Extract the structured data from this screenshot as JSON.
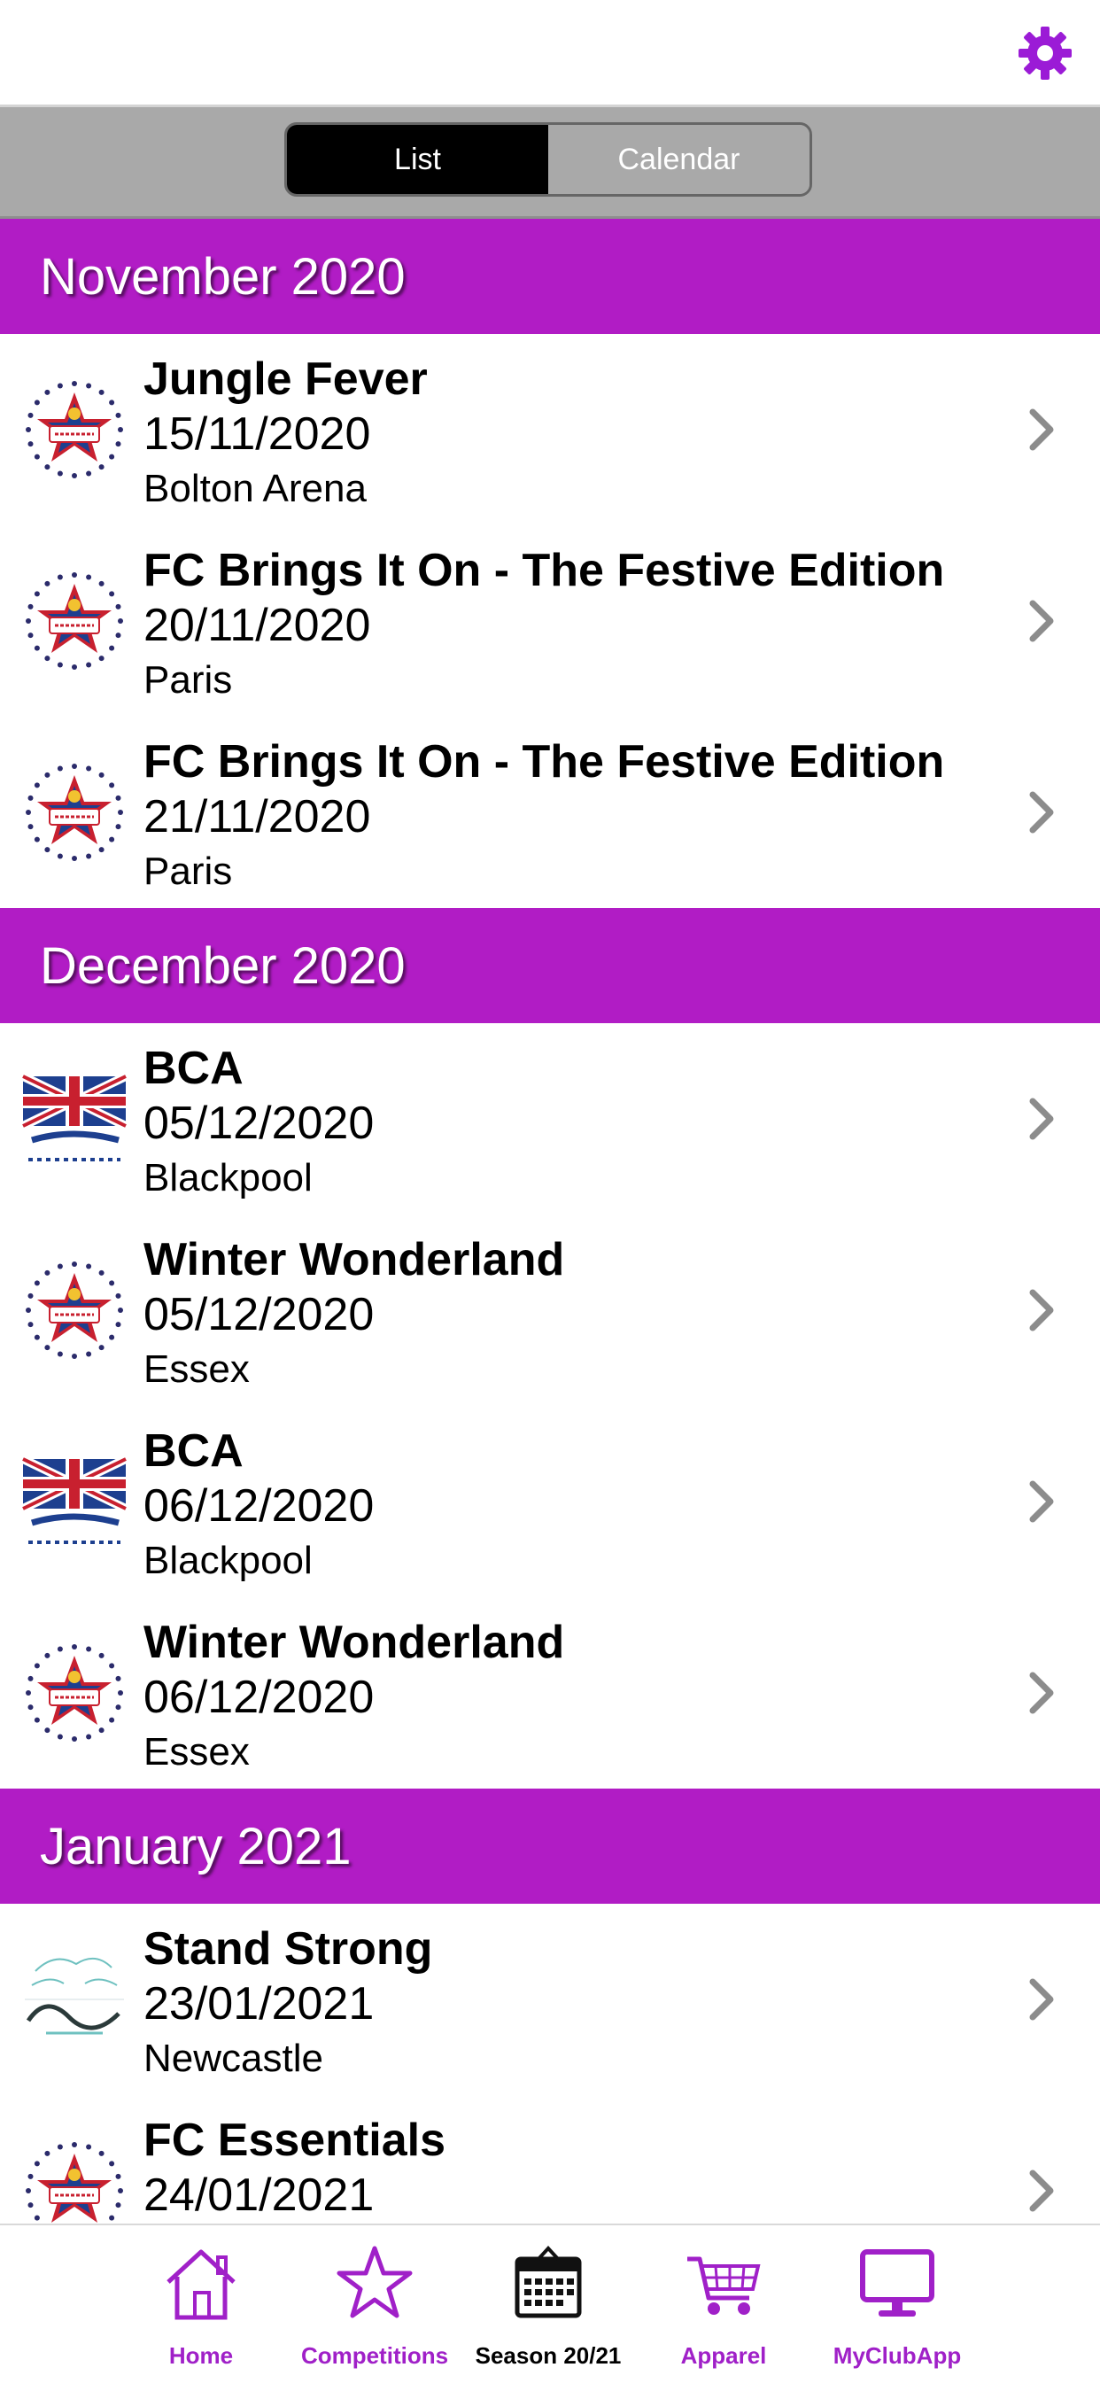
{
  "segmented": {
    "options": [
      "List",
      "Calendar"
    ],
    "selected": "List"
  },
  "months": [
    {
      "title": "November 2020",
      "events": [
        {
          "name": "Jungle Fever",
          "date": "15/11/2020",
          "venue": "Bolton Arena",
          "logo": "future-cheer"
        },
        {
          "name": "FC Brings It On - The Festive Edition",
          "date": "20/11/2020",
          "venue": "Paris",
          "logo": "future-cheer"
        },
        {
          "name": "FC Brings It On - The Festive Edition",
          "date": "21/11/2020",
          "venue": "Paris",
          "logo": "future-cheer"
        }
      ]
    },
    {
      "title": "December 2020",
      "events": [
        {
          "name": "BCA",
          "date": "05/12/2020",
          "venue": "Blackpool",
          "logo": "bca"
        },
        {
          "name": "Winter Wonderland",
          "date": "05/12/2020",
          "venue": "Essex",
          "logo": "future-cheer"
        },
        {
          "name": "BCA",
          "date": "06/12/2020",
          "venue": "Blackpool",
          "logo": "bca"
        },
        {
          "name": "Winter Wonderland",
          "date": "06/12/2020",
          "venue": "Essex",
          "logo": "future-cheer"
        }
      ]
    },
    {
      "title": "January 2021",
      "events": [
        {
          "name": "Stand Strong",
          "date": "23/01/2021",
          "venue": "Newcastle",
          "logo": "legacy"
        },
        {
          "name": "FC Essentials",
          "date": "24/01/2021",
          "venue": "",
          "logo": "future-cheer"
        }
      ]
    }
  ],
  "tabs": [
    {
      "label": "Home",
      "icon": "home-icon",
      "active": true
    },
    {
      "label": "Competitions",
      "icon": "star-icon",
      "active": true
    },
    {
      "label": "Season 20/21",
      "icon": "calendar-icon",
      "active": false
    },
    {
      "label": "Apparel",
      "icon": "cart-icon",
      "active": true
    },
    {
      "label": "MyClubApp",
      "icon": "monitor-icon",
      "active": true
    }
  ],
  "colors": {
    "accent": "#b11cc5",
    "tab_active": "#a020c8",
    "segment_bar": "#a9a9a9",
    "chevron": "#8c8c8c"
  }
}
